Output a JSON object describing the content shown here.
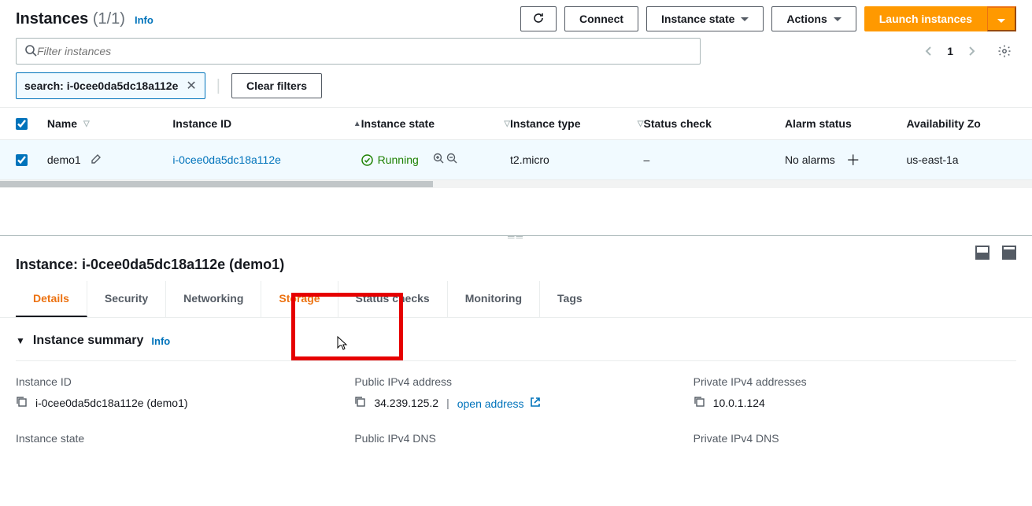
{
  "header": {
    "title": "Instances",
    "count": "(1/1)",
    "info": "Info",
    "buttons": {
      "connect": "Connect",
      "instanceState": "Instance state",
      "actions": "Actions",
      "launch": "Launch instances"
    }
  },
  "search": {
    "placeholder": "Filter instances"
  },
  "chips": {
    "search": "search: i-0cee0da5dc18a112e",
    "clear": "Clear filters"
  },
  "pager": {
    "current": "1"
  },
  "columns": {
    "name": "Name",
    "id": "Instance ID",
    "state": "Instance state",
    "type": "Instance type",
    "status": "Status check",
    "alarm": "Alarm status",
    "az": "Availability Zo"
  },
  "rows": [
    {
      "name": "demo1",
      "id": "i-0cee0da5dc18a112e",
      "state": "Running",
      "type": "t2.micro",
      "status": "–",
      "alarm": "No alarms",
      "az": "us-east-1a"
    }
  ],
  "pane": {
    "heading": "Instance: i-0cee0da5dc18a112e (demo1)"
  },
  "tabs": {
    "details": "Details",
    "security": "Security",
    "networking": "Networking",
    "storage": "Storage",
    "status": "Status checks",
    "monitoring": "Monitoring",
    "tags": "Tags"
  },
  "summary": {
    "title": "Instance summary",
    "info": "Info",
    "fields": {
      "instanceId": {
        "label": "Instance ID",
        "value": "i-0cee0da5dc18a112e (demo1)"
      },
      "publicIpv4": {
        "label": "Public IPv4 address",
        "value": "34.239.125.2",
        "openLabel": "open address"
      },
      "privateIpv4": {
        "label": "Private IPv4 addresses",
        "value": "10.0.1.124"
      },
      "instanceState": {
        "label": "Instance state"
      },
      "publicDns": {
        "label": "Public IPv4 DNS"
      },
      "privateDns": {
        "label": "Private IPv4 DNS"
      },
      "divider": "|"
    }
  }
}
